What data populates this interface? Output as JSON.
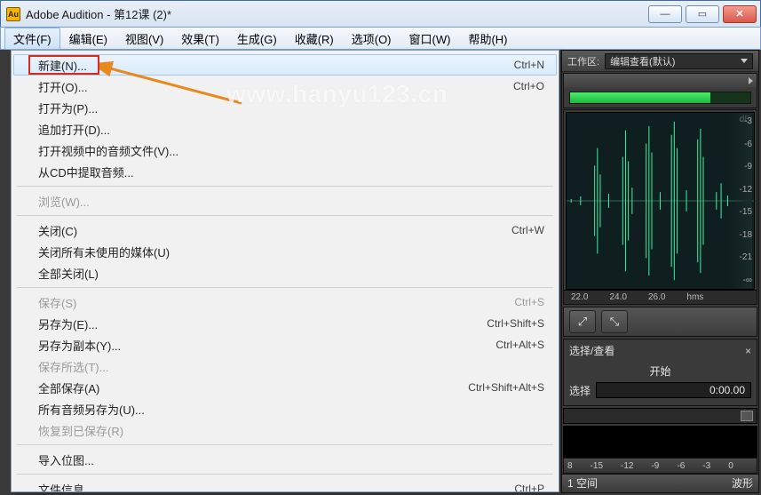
{
  "title": "Adobe Audition - 第12课 (2)*",
  "app_icon_text": "Au",
  "watermark": "www.hanyu123.cn",
  "menubar": [
    "文件(F)",
    "编辑(E)",
    "视图(V)",
    "效果(T)",
    "生成(G)",
    "收藏(R)",
    "选项(O)",
    "窗口(W)",
    "帮助(H)"
  ],
  "menubar_open_index": 0,
  "file_menu": [
    {
      "type": "item",
      "label": "新建(N)...",
      "shortcut": "Ctrl+N",
      "highlight": true
    },
    {
      "type": "item",
      "label": "打开(O)...",
      "shortcut": "Ctrl+O"
    },
    {
      "type": "item",
      "label": "打开为(P)..."
    },
    {
      "type": "item",
      "label": "追加打开(D)..."
    },
    {
      "type": "item",
      "label": "打开视频中的音频文件(V)..."
    },
    {
      "type": "item",
      "label": "从CD中提取音频..."
    },
    {
      "type": "sep"
    },
    {
      "type": "item",
      "label": "浏览(W)...",
      "disabled": true
    },
    {
      "type": "sep"
    },
    {
      "type": "item",
      "label": "关闭(C)",
      "shortcut": "Ctrl+W"
    },
    {
      "type": "item",
      "label": "关闭所有未使用的媒体(U)"
    },
    {
      "type": "item",
      "label": "全部关闭(L)"
    },
    {
      "type": "sep"
    },
    {
      "type": "item",
      "label": "保存(S)",
      "shortcut": "Ctrl+S",
      "disabled": true
    },
    {
      "type": "item",
      "label": "另存为(E)...",
      "shortcut": "Ctrl+Shift+S"
    },
    {
      "type": "item",
      "label": "另存为副本(Y)...",
      "shortcut": "Ctrl+Alt+S"
    },
    {
      "type": "item",
      "label": "保存所选(T)...",
      "disabled": true
    },
    {
      "type": "item",
      "label": "全部保存(A)",
      "shortcut": "Ctrl+Shift+Alt+S"
    },
    {
      "type": "item",
      "label": "所有音频另存为(U)..."
    },
    {
      "type": "item",
      "label": "恢复到已保存(R)",
      "disabled": true
    },
    {
      "type": "sep"
    },
    {
      "type": "item",
      "label": "导入位图..."
    },
    {
      "type": "sep"
    },
    {
      "type": "item",
      "label": "文件信息...",
      "shortcut": "Ctrl+P"
    }
  ],
  "workspace": {
    "label": "工作区:",
    "value": "编辑查看(默认)"
  },
  "db_scale": [
    "dB",
    "-3",
    "-6",
    "-9",
    "-12",
    "-15",
    "-18",
    "-21",
    "-∞"
  ],
  "wave_timeline": [
    "22.0",
    "24.0",
    "26.0",
    "hms"
  ],
  "selection_panel": {
    "tab": "选择/查看",
    "col": "开始",
    "row_label": "选择",
    "value": "0:00.00"
  },
  "bottom_ruler": [
    "8",
    "-15",
    "-12",
    "-9",
    "-6",
    "-3",
    "0"
  ],
  "footer": {
    "left": "1 空间",
    "right": "波形"
  }
}
